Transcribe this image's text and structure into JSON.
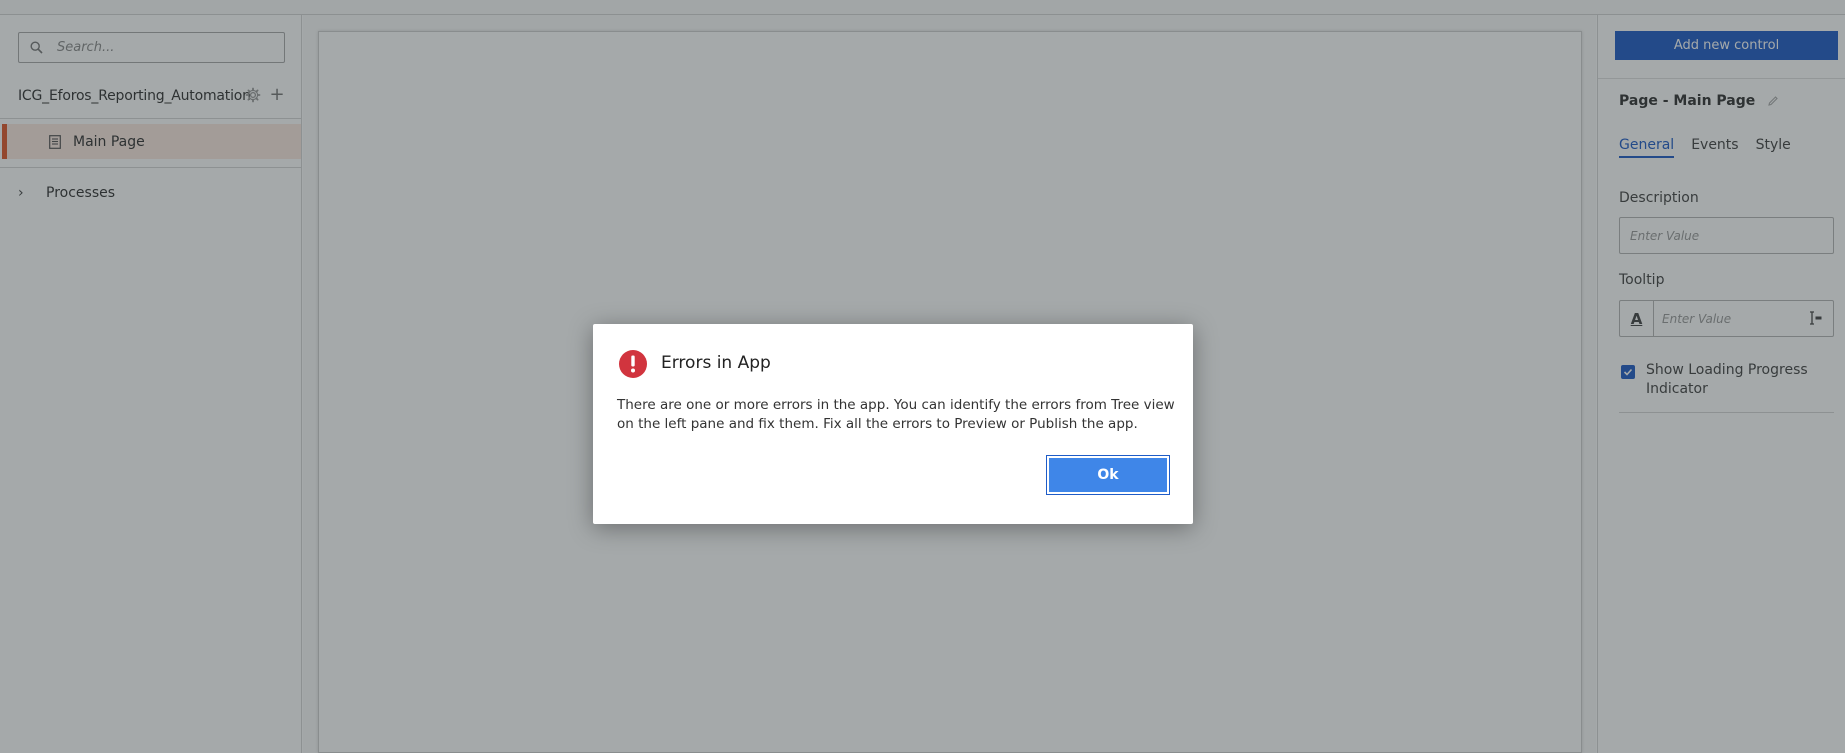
{
  "left_panel": {
    "search": {
      "placeholder": "Search..."
    },
    "app_name": "ICG_Eforos_Reporting_Automation",
    "tree": {
      "page_label": "Main Page",
      "processes_label": "Processes"
    },
    "icons": {
      "search": "search-icon",
      "gear": "gear-icon",
      "add": "plus-icon",
      "page": "page-icon",
      "chevron": "chevron-right-icon"
    },
    "accent_color": "#e0562a"
  },
  "right_panel": {
    "add_control_label": "Add new control",
    "page_title": "Page - Main Page",
    "tabs": [
      {
        "label": "General",
        "active": true
      },
      {
        "label": "Events",
        "active": false
      },
      {
        "label": "Style",
        "active": false
      }
    ],
    "description": {
      "label": "Description",
      "placeholder": "Enter Value"
    },
    "tooltip": {
      "label": "Tooltip",
      "placeholder": "Enter Value",
      "font_button": "A"
    },
    "loading_indicator": {
      "label": "Show Loading Progress Indicator",
      "checked": true
    },
    "primary_color": "#1f5cc7"
  },
  "dialog": {
    "title": "Errors in App",
    "message": "There are one or more errors in the app. You can identify the errors from Tree view on the left pane and fix them. Fix all the errors to Preview or Publish the app.",
    "ok_label": "Ok",
    "icon": "error-icon",
    "icon_color": "#d1343e"
  }
}
